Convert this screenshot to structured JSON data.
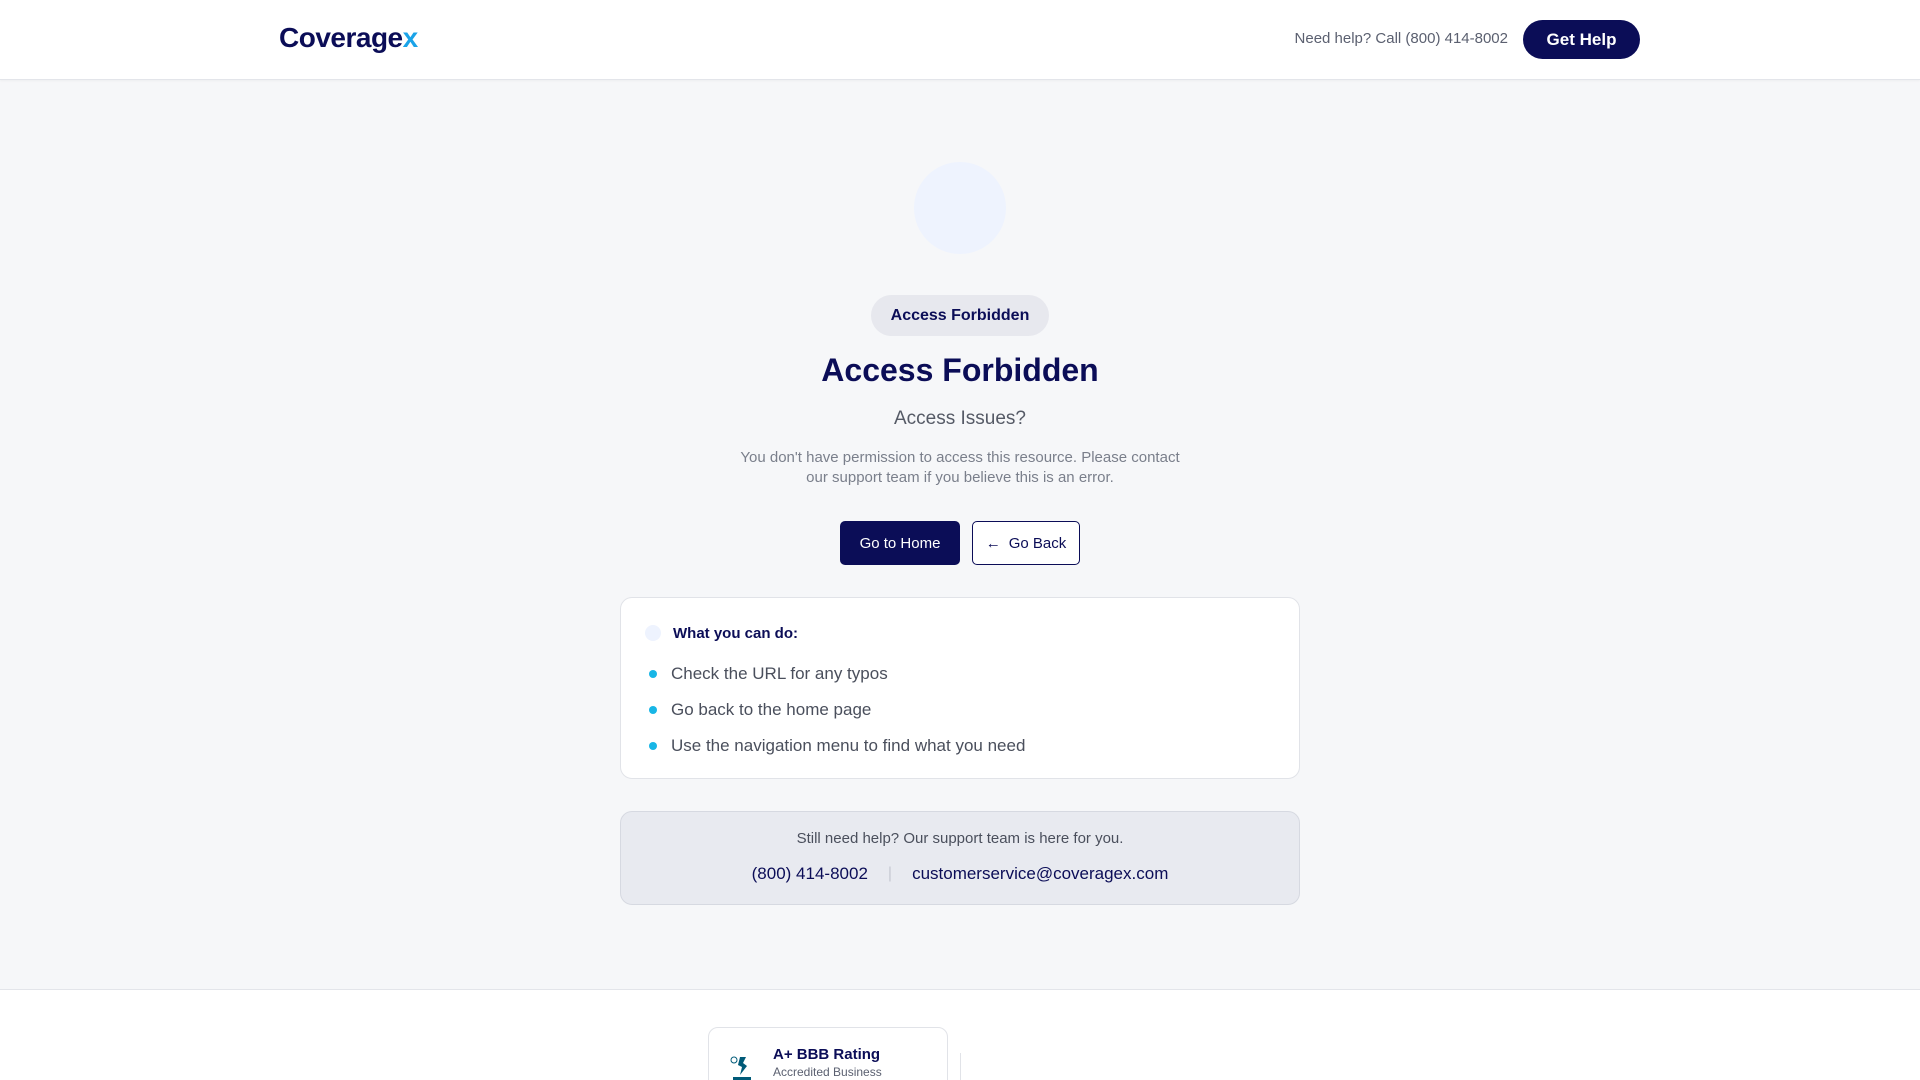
{
  "header": {
    "logo_main": "Coverage",
    "logo_accent": "x",
    "help_text": "Need help? Call (800) 414-8002",
    "get_help_label": "Get Help"
  },
  "main": {
    "badge": "Access Forbidden",
    "title": "Access Forbidden",
    "subtitle": "Access Issues?",
    "description": "You don't have permission to access this resource. Please contact our support team if you believe this is an error.",
    "home_button": "Go to Home",
    "back_button": "Go Back"
  },
  "tips": {
    "title": "What you can do:",
    "items": [
      "Check the URL for any typos",
      "Go back to the home page",
      "Use the navigation menu to find what you need"
    ]
  },
  "contact": {
    "message": "Still need help? Our support team is here for you.",
    "phone": "(800) 414-8002",
    "email": "customerservice@coveragex.com"
  },
  "footer": {
    "bbb_title": "A+ BBB Rating",
    "bbb_subtitle": "Accredited Business"
  },
  "colors": {
    "brand_navy": "#0b0d57",
    "accent_cyan": "#18b6e6",
    "page_bg": "#f6f7f9"
  }
}
